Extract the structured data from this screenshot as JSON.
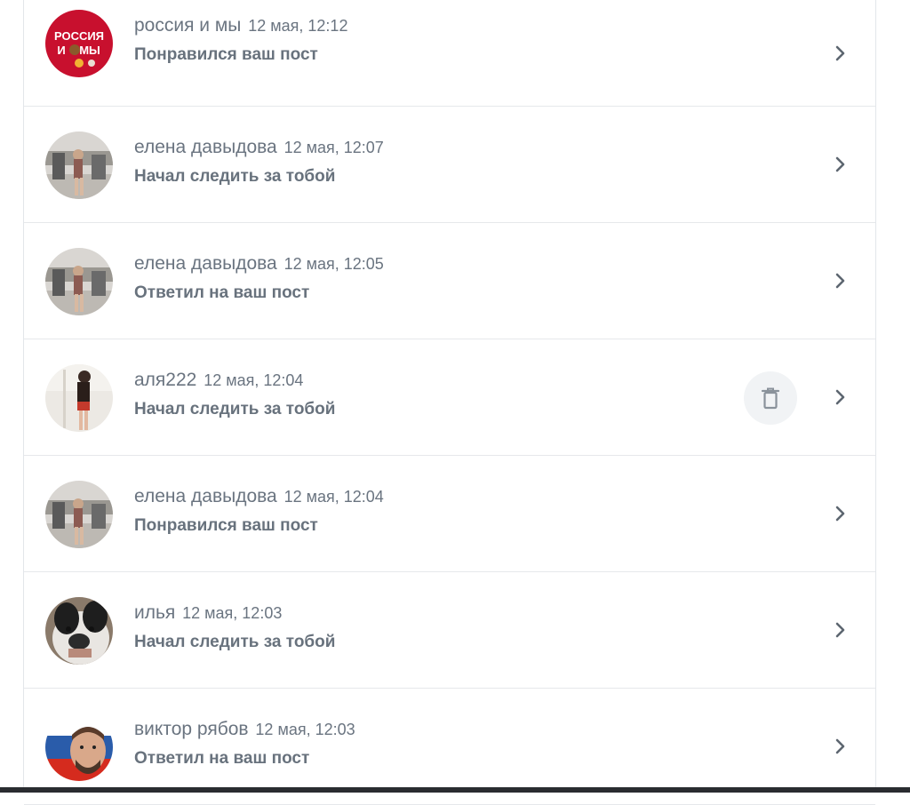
{
  "notifications": [
    {
      "name": "россия и мы",
      "time": "12 мая, 12:12",
      "action": "Понравился ваш пост",
      "avatar_text_1": "РОССИЯ",
      "avatar_text_2": "И",
      "avatar_text_3": "МЫ"
    },
    {
      "name": "елена давыдова",
      "time": "12 мая, 12:07",
      "action": "Начал следить за тобой"
    },
    {
      "name": "елена давыдова",
      "time": "12 мая, 12:05",
      "action": "Ответил на ваш пост"
    },
    {
      "name": "аля222",
      "time": "12 мая, 12:04",
      "action": "Начал следить за тобой"
    },
    {
      "name": "елена давыдова",
      "time": "12 мая, 12:04",
      "action": "Понравился ваш пост"
    },
    {
      "name": "илья",
      "time": "12 мая, 12:03",
      "action": "Начал следить за тобой"
    },
    {
      "name": "виктор рябов",
      "time": "12 мая, 12:03",
      "action": "Ответил на ваш пост"
    }
  ],
  "icons": {
    "chevron": "chevron-right-icon",
    "delete": "trash-icon"
  },
  "colors": {
    "text": "#6a7480",
    "divider": "#e6e8eb",
    "russia_red": "#c8102e"
  }
}
